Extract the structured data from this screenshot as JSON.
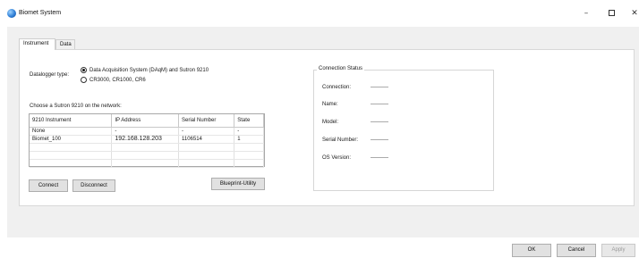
{
  "window": {
    "title": "Biomet System",
    "minimize_glyph": "–",
    "close_glyph": "✕"
  },
  "tabs": [
    {
      "label": "Instrument",
      "selected": true
    },
    {
      "label": "Data",
      "selected": false
    }
  ],
  "datalogger": {
    "label": "Datalogger type:",
    "options": [
      {
        "label": "Data Acquisition System (DAqM) and Sutron 9210",
        "selected": true
      },
      {
        "label": "CR3000, CR1000, CR6",
        "selected": false
      }
    ]
  },
  "network": {
    "label": "Choose a Sutron 9210 on the network:",
    "columns": [
      "9210 Instrument",
      "IP Address",
      "Serial Number",
      "State"
    ],
    "rows": [
      [
        "None",
        "-",
        "-",
        "-"
      ],
      [
        "Biomet_100",
        "192.168.128.203",
        "1106514",
        "1"
      ]
    ]
  },
  "buttons": {
    "connect": "Connect",
    "disconnect": "Disconnect",
    "blueprint": "Blueprint-Utility"
  },
  "connection_status": {
    "title": "Connection Status",
    "fields": [
      {
        "label": "Connection:",
        "value": "----------"
      },
      {
        "label": "Name:",
        "value": "----------"
      },
      {
        "label": "Model:",
        "value": "----------"
      },
      {
        "label": "Serial Number:",
        "value": "----------"
      },
      {
        "label": "OS Version:",
        "value": "----------"
      }
    ]
  },
  "footer": {
    "ok": "OK",
    "cancel": "Cancel",
    "apply": "Apply",
    "apply_enabled": false
  }
}
